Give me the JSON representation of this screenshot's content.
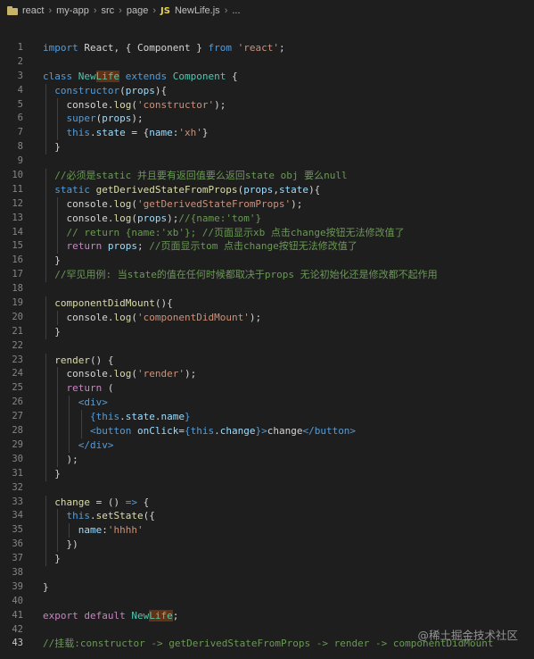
{
  "breadcrumb": {
    "items": [
      "react",
      "my-app",
      "src",
      "page"
    ],
    "file_badge": "JS",
    "file": "NewLife.js",
    "more": "..."
  },
  "editor": {
    "active_line": 43,
    "lines": [
      {
        "n": "1",
        "tokens": [
          [
            "import ",
            "kw"
          ],
          [
            "React",
            ""
          ],
          [
            ", { ",
            ""
          ],
          [
            "Component",
            ""
          ],
          [
            " } ",
            ""
          ],
          [
            "from ",
            "kw"
          ],
          [
            "'react'",
            "str"
          ],
          [
            ";",
            ""
          ]
        ]
      },
      {
        "n": "2",
        "tokens": []
      },
      {
        "n": "3",
        "tokens": [
          [
            "class ",
            "kw"
          ],
          [
            "New",
            "cls"
          ],
          [
            "Life",
            "cls hl"
          ],
          [
            " extends ",
            "kw"
          ],
          [
            "Component",
            "cls"
          ],
          [
            " {",
            ""
          ]
        ]
      },
      {
        "n": "4",
        "tokens": [
          [
            "  constructor",
            "kw"
          ],
          [
            "(",
            "pl"
          ],
          [
            "props",
            "var"
          ],
          [
            "){",
            ""
          ]
        ]
      },
      {
        "n": "5",
        "tokens": [
          [
            "    console",
            ""
          ],
          [
            ".",
            "pl"
          ],
          [
            "log",
            "fn"
          ],
          [
            "(",
            "pl"
          ],
          [
            "'constructor'",
            "str"
          ],
          [
            ");",
            ""
          ]
        ]
      },
      {
        "n": "6",
        "tokens": [
          [
            "    super",
            "kw"
          ],
          [
            "(",
            "pl"
          ],
          [
            "props",
            "var"
          ],
          [
            ");",
            ""
          ]
        ]
      },
      {
        "n": "7",
        "tokens": [
          [
            "    this",
            "kw"
          ],
          [
            ".",
            "pl"
          ],
          [
            "state",
            "var"
          ],
          [
            " = {",
            ""
          ],
          [
            "name",
            "var"
          ],
          [
            ":",
            ""
          ],
          [
            "'xh'",
            "str"
          ],
          [
            "}",
            ""
          ]
        ]
      },
      {
        "n": "8",
        "tokens": [
          [
            "  }",
            ""
          ]
        ]
      },
      {
        "n": "9",
        "tokens": []
      },
      {
        "n": "10",
        "tokens": [
          [
            "  //必须是static 并且要有返回值要么返回state obj 要么null",
            "cm"
          ]
        ]
      },
      {
        "n": "11",
        "tokens": [
          [
            "  static ",
            "kw"
          ],
          [
            "getDerivedStateFromProps",
            "fn"
          ],
          [
            "(",
            "pl"
          ],
          [
            "props",
            "var"
          ],
          [
            ",",
            ""
          ],
          [
            "state",
            "var"
          ],
          [
            "){",
            ""
          ]
        ]
      },
      {
        "n": "12",
        "tokens": [
          [
            "    console",
            ""
          ],
          [
            ".",
            "pl"
          ],
          [
            "log",
            "fn"
          ],
          [
            "(",
            "pl"
          ],
          [
            "'getDerivedStateFromProps'",
            "str"
          ],
          [
            ");",
            ""
          ]
        ]
      },
      {
        "n": "13",
        "tokens": [
          [
            "    console",
            ""
          ],
          [
            ".",
            "pl"
          ],
          [
            "log",
            "fn"
          ],
          [
            "(",
            "pl"
          ],
          [
            "props",
            "var"
          ],
          [
            ");",
            ""
          ],
          [
            "//{name:'tom'}",
            "cm"
          ]
        ]
      },
      {
        "n": "14",
        "tokens": [
          [
            "    // return {name:'xb'}; //页面显示xb 点击change按钮无法修改值了",
            "cm"
          ]
        ]
      },
      {
        "n": "15",
        "tokens": [
          [
            "    return ",
            "cf"
          ],
          [
            "props",
            "var"
          ],
          [
            "; ",
            ""
          ],
          [
            "//页面显示tom 点击change按钮无法修改值了",
            "cm"
          ]
        ]
      },
      {
        "n": "16",
        "tokens": [
          [
            "  }",
            ""
          ]
        ]
      },
      {
        "n": "17",
        "tokens": [
          [
            "  //罕见用例: 当state的值在任何时候都取决于props 无论初始化还是修改都不起作用",
            "cm"
          ]
        ]
      },
      {
        "n": "18",
        "tokens": []
      },
      {
        "n": "19",
        "tokens": [
          [
            "  componentDidMount",
            "fn"
          ],
          [
            "(){",
            ""
          ]
        ]
      },
      {
        "n": "20",
        "tokens": [
          [
            "    console",
            ""
          ],
          [
            ".",
            "pl"
          ],
          [
            "log",
            "fn"
          ],
          [
            "(",
            "pl"
          ],
          [
            "'componentDidMount'",
            "str"
          ],
          [
            ");",
            ""
          ]
        ]
      },
      {
        "n": "21",
        "tokens": [
          [
            "  }",
            ""
          ]
        ]
      },
      {
        "n": "22",
        "tokens": []
      },
      {
        "n": "23",
        "tokens": [
          [
            "  render",
            "fn"
          ],
          [
            "() {",
            ""
          ]
        ]
      },
      {
        "n": "24",
        "tokens": [
          [
            "    console",
            ""
          ],
          [
            ".",
            "pl"
          ],
          [
            "log",
            "fn"
          ],
          [
            "(",
            "pl"
          ],
          [
            "'render'",
            "str"
          ],
          [
            ");",
            ""
          ]
        ]
      },
      {
        "n": "25",
        "tokens": [
          [
            "    return ",
            "cf"
          ],
          [
            "(",
            ""
          ]
        ]
      },
      {
        "n": "26",
        "tokens": [
          [
            "      <div>",
            "tag"
          ]
        ]
      },
      {
        "n": "27",
        "tokens": [
          [
            "        {",
            "kw"
          ],
          [
            "this",
            "kw"
          ],
          [
            ".",
            "pl"
          ],
          [
            "state",
            "var"
          ],
          [
            ".",
            "pl"
          ],
          [
            "name",
            "var"
          ],
          [
            "}",
            "kw"
          ]
        ]
      },
      {
        "n": "28",
        "tokens": [
          [
            "        <button ",
            "tag"
          ],
          [
            "onClick",
            "var"
          ],
          [
            "=",
            ""
          ],
          [
            "{",
            "kw"
          ],
          [
            "this",
            "kw"
          ],
          [
            ".",
            "pl"
          ],
          [
            "change",
            "var"
          ],
          [
            "}",
            "kw"
          ],
          [
            ">",
            "tag"
          ],
          [
            "change",
            ""
          ],
          [
            "</button>",
            "tag"
          ]
        ]
      },
      {
        "n": "29",
        "tokens": [
          [
            "      </div>",
            "tag"
          ]
        ]
      },
      {
        "n": "30",
        "tokens": [
          [
            "    );",
            ""
          ]
        ]
      },
      {
        "n": "31",
        "tokens": [
          [
            "  }",
            ""
          ]
        ]
      },
      {
        "n": "32",
        "tokens": []
      },
      {
        "n": "33",
        "tokens": [
          [
            "  change",
            "fn"
          ],
          [
            " = () ",
            ""
          ],
          [
            "=>",
            "kw"
          ],
          [
            " {",
            ""
          ]
        ]
      },
      {
        "n": "34",
        "tokens": [
          [
            "    this",
            "kw"
          ],
          [
            ".",
            "pl"
          ],
          [
            "setState",
            "fn"
          ],
          [
            "({",
            ""
          ]
        ]
      },
      {
        "n": "35",
        "tokens": [
          [
            "      name",
            "var"
          ],
          [
            ":",
            ""
          ],
          [
            "'hhhh'",
            "str"
          ]
        ]
      },
      {
        "n": "36",
        "tokens": [
          [
            "    })",
            ""
          ]
        ]
      },
      {
        "n": "37",
        "tokens": [
          [
            "  }",
            ""
          ]
        ]
      },
      {
        "n": "38",
        "tokens": []
      },
      {
        "n": "39",
        "tokens": [
          [
            "}",
            ""
          ]
        ]
      },
      {
        "n": "40",
        "tokens": []
      },
      {
        "n": "41",
        "tokens": [
          [
            "export ",
            "cf"
          ],
          [
            "default ",
            "cf"
          ],
          [
            "New",
            "cls"
          ],
          [
            "Life",
            "cls hl"
          ],
          [
            ";",
            ""
          ]
        ]
      },
      {
        "n": "42",
        "tokens": []
      },
      {
        "n": "43",
        "tokens": [
          [
            "//挂载:constructor -> getDerivedStateFromProps -> render -> componentDidMount",
            "cm"
          ]
        ]
      }
    ]
  },
  "watermark": "@稀土掘金技术社区"
}
